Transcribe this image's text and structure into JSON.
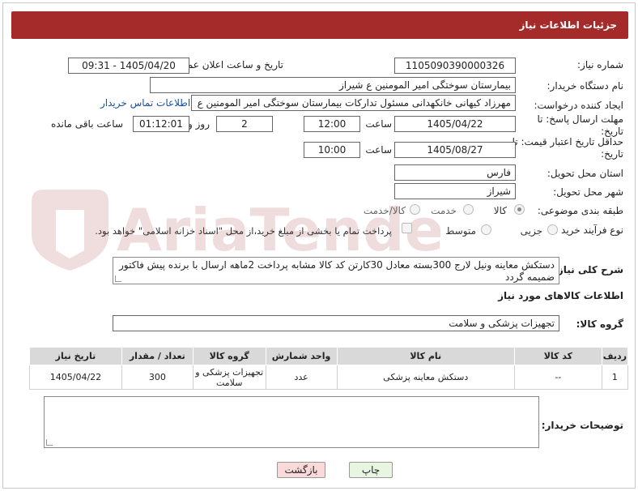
{
  "header": {
    "title": "جزئیات اطلاعات نیاز"
  },
  "fields": {
    "need_number_label": "شماره نیاز:",
    "need_number": "1105090390000326",
    "announce_label": "تاریخ و ساعت اعلان عمومی:",
    "announce_value": "1405/04/20 - 09:31",
    "buyer_org_label": "نام دستگاه خریدار:",
    "buyer_org": "بیمارستان سوختگی امیر المومنین  ع  شیراز",
    "requester_label": "ایجاد کننده درخواست:",
    "requester": "مهرزاد کیهانی خانکهدانی مسئول تدارکات بیمارستان سوختگی امیر المومنین  ع",
    "contact_link": "اطلاعات تماس خریدار",
    "reply_deadline_label": "مهلت ارسال پاسخ: تا تاریخ:",
    "reply_date": "1405/04/22",
    "time_label": "ساعت",
    "reply_time": "12:00",
    "days_value": "2",
    "days_label": "روز و",
    "remaining_time": "01:12:01",
    "remaining_label": "ساعت باقی مانده",
    "price_validity_label": "حداقل تاریخ اعتبار قیمت: تا تاریخ:",
    "price_date": "1405/08/27",
    "price_time_label": "ساعت",
    "price_time": "10:00",
    "province_label": "استان محل تحویل:",
    "province": "فارس",
    "city_label": "شهر محل تحویل:",
    "city": "شیراز",
    "category_label": "طبقه بندی موضوعی:",
    "category_options": [
      "کالا",
      "خدمت",
      "کالا/خدمت"
    ],
    "process_label": "نوع فرآیند خرید :",
    "process_options": [
      "جزیی",
      "متوسط"
    ],
    "payment_note": "پرداخت تمام یا بخشی از مبلغ خرید،از محل \"اسناد خزانه اسلامی\" خواهد بود."
  },
  "description": {
    "label": "شرح کلی نیاز:",
    "text": "دستکش معاینه ونیل لارج 300بسته معادل 30کارتن کد کالا مشابه پرداخت 2ماهه ارسال با برنده  پیش فاکتور ضمیمه گردد"
  },
  "goods": {
    "section_title": "اطلاعات کالاهای مورد نیاز",
    "group_label": "گروه کالا:",
    "group_value": "تجهیزات پزشکی و سلامت",
    "columns": [
      "ردیف",
      "کد کالا",
      "نام کالا",
      "واحد شمارش",
      "گروه کالا",
      "تعداد / مقدار",
      "تاریخ نیاز"
    ],
    "rows": [
      [
        "1",
        "--",
        "دستکش معاینه پزشکی",
        "عدد",
        "تجهیزات پزشکی و سلامت",
        "300",
        "1405/04/22"
      ]
    ]
  },
  "buyer_notes": {
    "label": "توضیحات خریدار:"
  },
  "buttons": {
    "print": "چاپ",
    "back": "بازگشت"
  },
  "watermark": {
    "text": "AriaTender.net"
  },
  "colors": {
    "header_bg": "#a52a2a",
    "link": "#1a4fa0",
    "back_button_bg": "#f9d9d9",
    "print_button_bg": "#e8f5e1"
  }
}
